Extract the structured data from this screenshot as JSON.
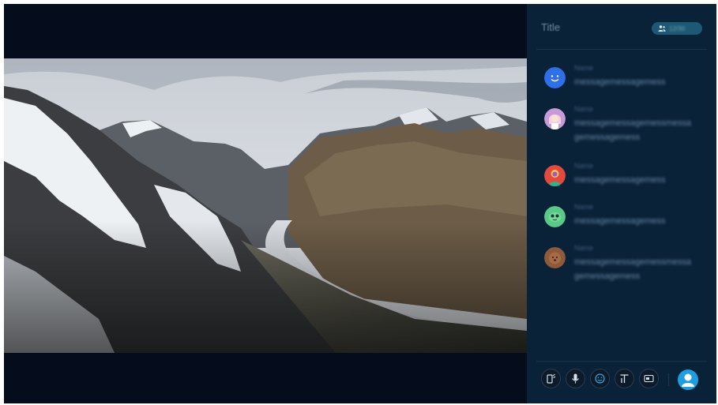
{
  "panel": {
    "title": "Title",
    "member_count": "12/30"
  },
  "messages": [
    {
      "name": "Name",
      "text": "messagemessagemess",
      "avatar_color": "#2f6fe8"
    },
    {
      "name": "Name",
      "text": "messagemessagemessmessagemessagemess",
      "avatar_color": "#c79ad8"
    },
    {
      "name": "Name",
      "text": "messagemessagemess",
      "avatar_color": "#e24a3f"
    },
    {
      "name": "Name",
      "text": "messagemessagemess",
      "avatar_color": "#58c987"
    },
    {
      "name": "Name",
      "text": "messagemessagemessmessagemessagemess",
      "avatar_color": "#8e5a3c"
    }
  ],
  "toolbar": {
    "items": [
      "screen-share-icon",
      "microphone-icon",
      "emoji-icon",
      "text-icon",
      "caption-icon"
    ]
  },
  "colors": {
    "background": "#050d1c",
    "panel": "#0a2238",
    "accent": "#1d9ee0"
  }
}
